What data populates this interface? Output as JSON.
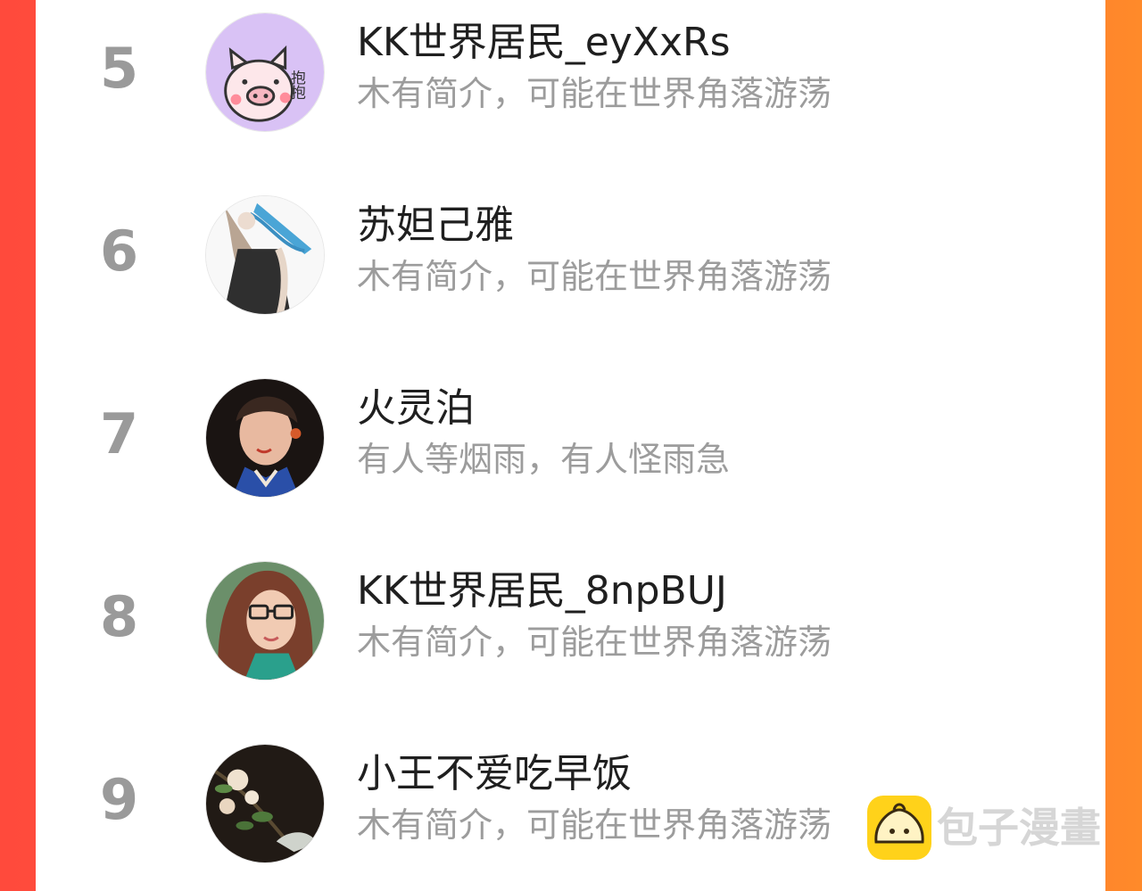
{
  "leaderboard": {
    "entries": [
      {
        "rank": "5",
        "name": "KK世界居民_eyXxRs",
        "bio": "木有简介，可能在世界角落游荡",
        "avatar": "pig-sticker-avatar",
        "avatar_text": "抱抱"
      },
      {
        "rank": "6",
        "name": "苏妲己雅",
        "bio": "木有简介，可能在世界角落游荡",
        "avatar": "illustrated-girl-avatar"
      },
      {
        "rank": "7",
        "name": "火灵泊",
        "bio": "有人等烟雨，有人怪雨急",
        "avatar": "young-man-photo-avatar"
      },
      {
        "rank": "8",
        "name": "KK世界居民_8npBUJ",
        "bio": "木有简介，可能在世界角落游荡",
        "avatar": "woman-glasses-photo-avatar"
      },
      {
        "rank": "9",
        "name": "小王不爱吃早饭",
        "bio": "木有简介，可能在世界角落游荡",
        "avatar": "flower-painting-avatar"
      }
    ]
  },
  "watermark": {
    "text": "包子漫畫",
    "icon": "bun-logo-icon"
  },
  "colors": {
    "background_left": "#ff4a3c",
    "background_right": "#ff8a2a",
    "panel": "#ffffff",
    "rank": "#9a9a9a",
    "name": "#1f1f1f",
    "bio": "#9c9c9c",
    "watermark_logo": "#ffd21a"
  }
}
